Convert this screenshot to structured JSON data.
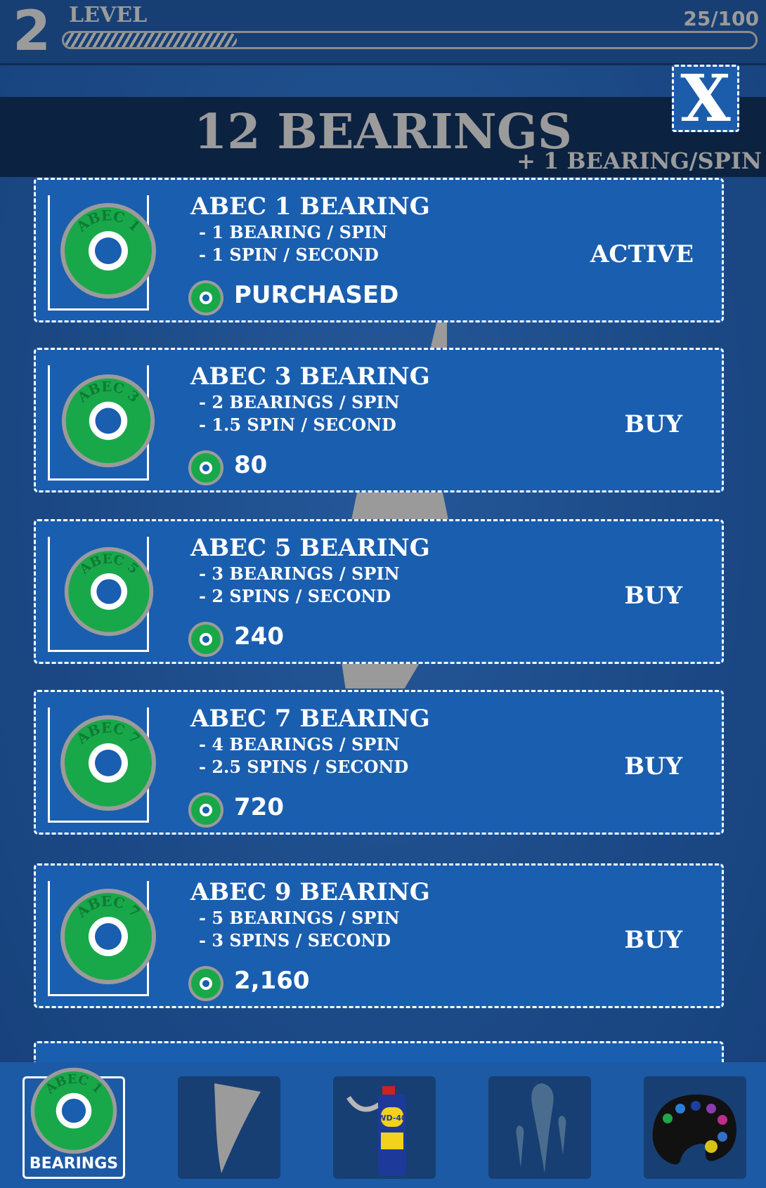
{
  "level": {
    "number": "2",
    "label": "LEVEL",
    "progress_text": "25/100",
    "progress_fraction": 0.25
  },
  "header": {
    "title": "12 BEARINGS",
    "subtitle": "+ 1 BEARING/SPIN",
    "close_label": "X"
  },
  "bearings": [
    {
      "title": "ABEC 1 BEARING",
      "line1": "- 1 BEARING / SPIN",
      "line2": "- 1 SPIN / SECOND",
      "price": "PURCHASED",
      "action": "ACTIVE",
      "badge": "ABEC 1"
    },
    {
      "title": "ABEC 3 BEARING",
      "line1": "- 2 BEARINGS / SPIN",
      "line2": "- 1.5 SPIN / SECOND",
      "price": "80",
      "action": "BUY",
      "badge": "ABEC 3"
    },
    {
      "title": "ABEC 5 BEARING",
      "line1": "- 3 BEARINGS / SPIN",
      "line2": "- 2 SPINS / SECOND",
      "price": "240",
      "action": "BUY",
      "badge": "ABEC 5"
    },
    {
      "title": "ABEC 7 BEARING",
      "line1": "- 4 BEARINGS / SPIN",
      "line2": "- 2.5 SPINS / SECOND",
      "price": "720",
      "action": "BUY",
      "badge": "ABEC 7"
    },
    {
      "title": "ABEC 9 BEARING",
      "line1": "- 5 BEARINGS / SPIN",
      "line2": "- 3 SPINS / SECOND",
      "price": "2,160",
      "action": "BUY",
      "badge": "ABEC 7"
    }
  ],
  "nav": {
    "bearings_label": "BEARINGS",
    "bearings_badge": "ABEC 1",
    "items": [
      "bearing-icon",
      "spinner-arm-icon",
      "lubricant-can-icon",
      "splash-icon",
      "paint-palette-icon"
    ],
    "can_text": "WD-40"
  },
  "colors": {
    "bearing_green": "#18a84a",
    "bearing_ring": "#9b9b9b",
    "card_blue": "#1a5eaf",
    "background": "#1d4d89",
    "header_band": "#0c2241"
  }
}
